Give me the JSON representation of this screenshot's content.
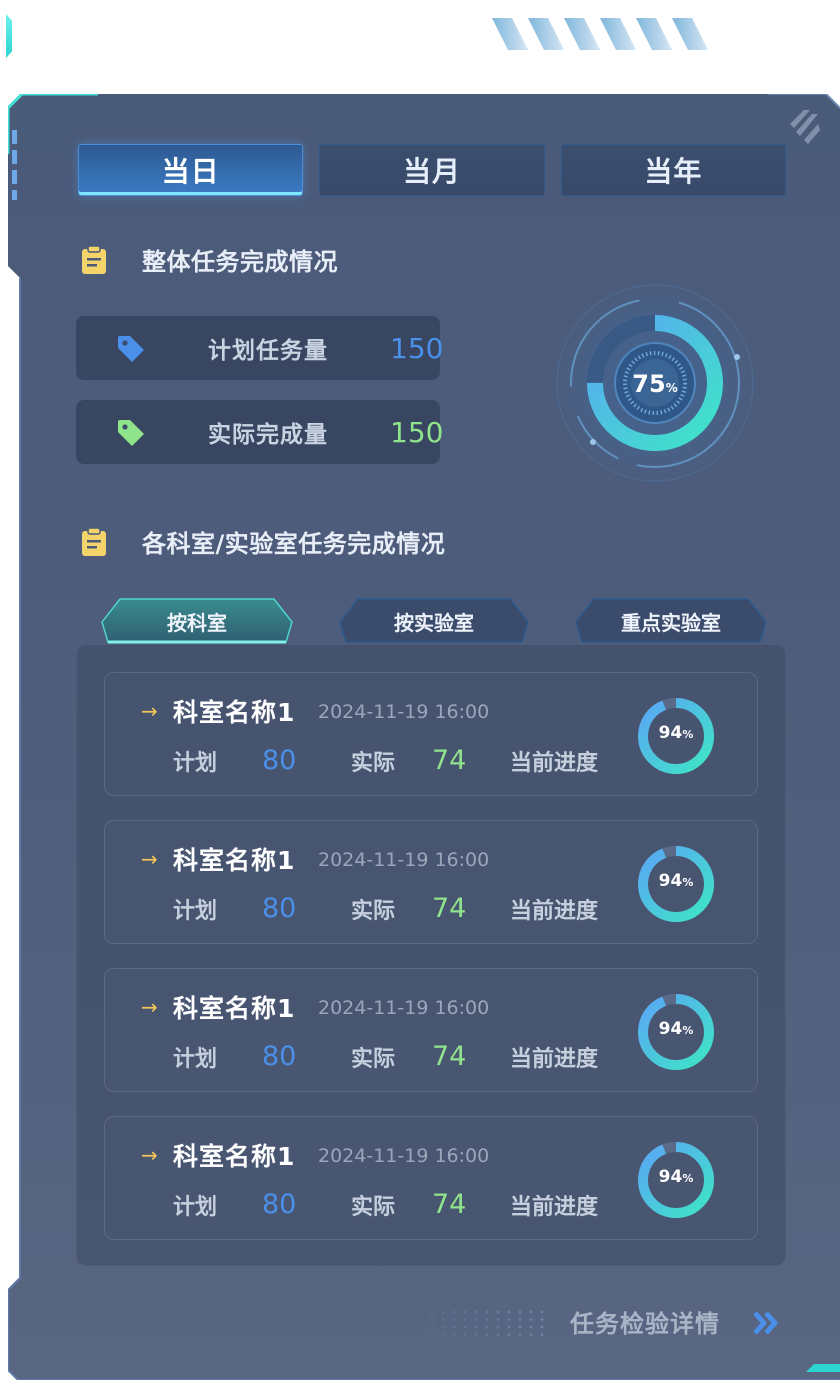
{
  "colors": {
    "accent_cyan": "#2bd4d0",
    "value_blue": "#4a8fe8",
    "value_green": "#8fe38a",
    "ring_start": "#3ee6c6",
    "ring_end": "#5aa6f5",
    "icon_yellow": "#f5d36b"
  },
  "period_tabs": [
    {
      "label": "当日",
      "active": true
    },
    {
      "label": "当月",
      "active": false
    },
    {
      "label": "当年",
      "active": false
    }
  ],
  "overall": {
    "title": "整体任务完成情况",
    "planned": {
      "label": "计划任务量",
      "value": "150",
      "icon": "tag-icon"
    },
    "actual": {
      "label": "实际完成量",
      "value": "150",
      "icon": "tag-icon"
    },
    "progress": {
      "value": "75",
      "unit": "%",
      "fraction": 0.75
    }
  },
  "departments": {
    "title": "各科室/实验室任务完成情况",
    "tabs": [
      {
        "label": "按科室",
        "active": true
      },
      {
        "label": "按实验室",
        "active": false
      },
      {
        "label": "重点实验室",
        "active": false
      }
    ],
    "items": [
      {
        "name": "科室名称1",
        "time": "2024-11-19 16:00",
        "plan_label": "计划",
        "plan": "80",
        "actual_label": "实际",
        "actual": "74",
        "progress_label": "当前进度",
        "progress": "94",
        "unit": "%",
        "fraction": 0.94
      },
      {
        "name": "科室名称1",
        "time": "2024-11-19 16:00",
        "plan_label": "计划",
        "plan": "80",
        "actual_label": "实际",
        "actual": "74",
        "progress_label": "当前进度",
        "progress": "94",
        "unit": "%",
        "fraction": 0.94
      },
      {
        "name": "科室名称1",
        "time": "2024-11-19 16:00",
        "plan_label": "计划",
        "plan": "80",
        "actual_label": "实际",
        "actual": "74",
        "progress_label": "当前进度",
        "progress": "94",
        "unit": "%",
        "fraction": 0.94
      },
      {
        "name": "科室名称1",
        "time": "2024-11-19 16:00",
        "plan_label": "计划",
        "plan": "80",
        "actual_label": "实际",
        "actual": "74",
        "progress_label": "当前进度",
        "progress": "94",
        "unit": "%",
        "fraction": 0.94
      }
    ]
  },
  "footer": {
    "detail_label": "任务检验详情",
    "detail_icon": "double-chevron-right-icon"
  }
}
